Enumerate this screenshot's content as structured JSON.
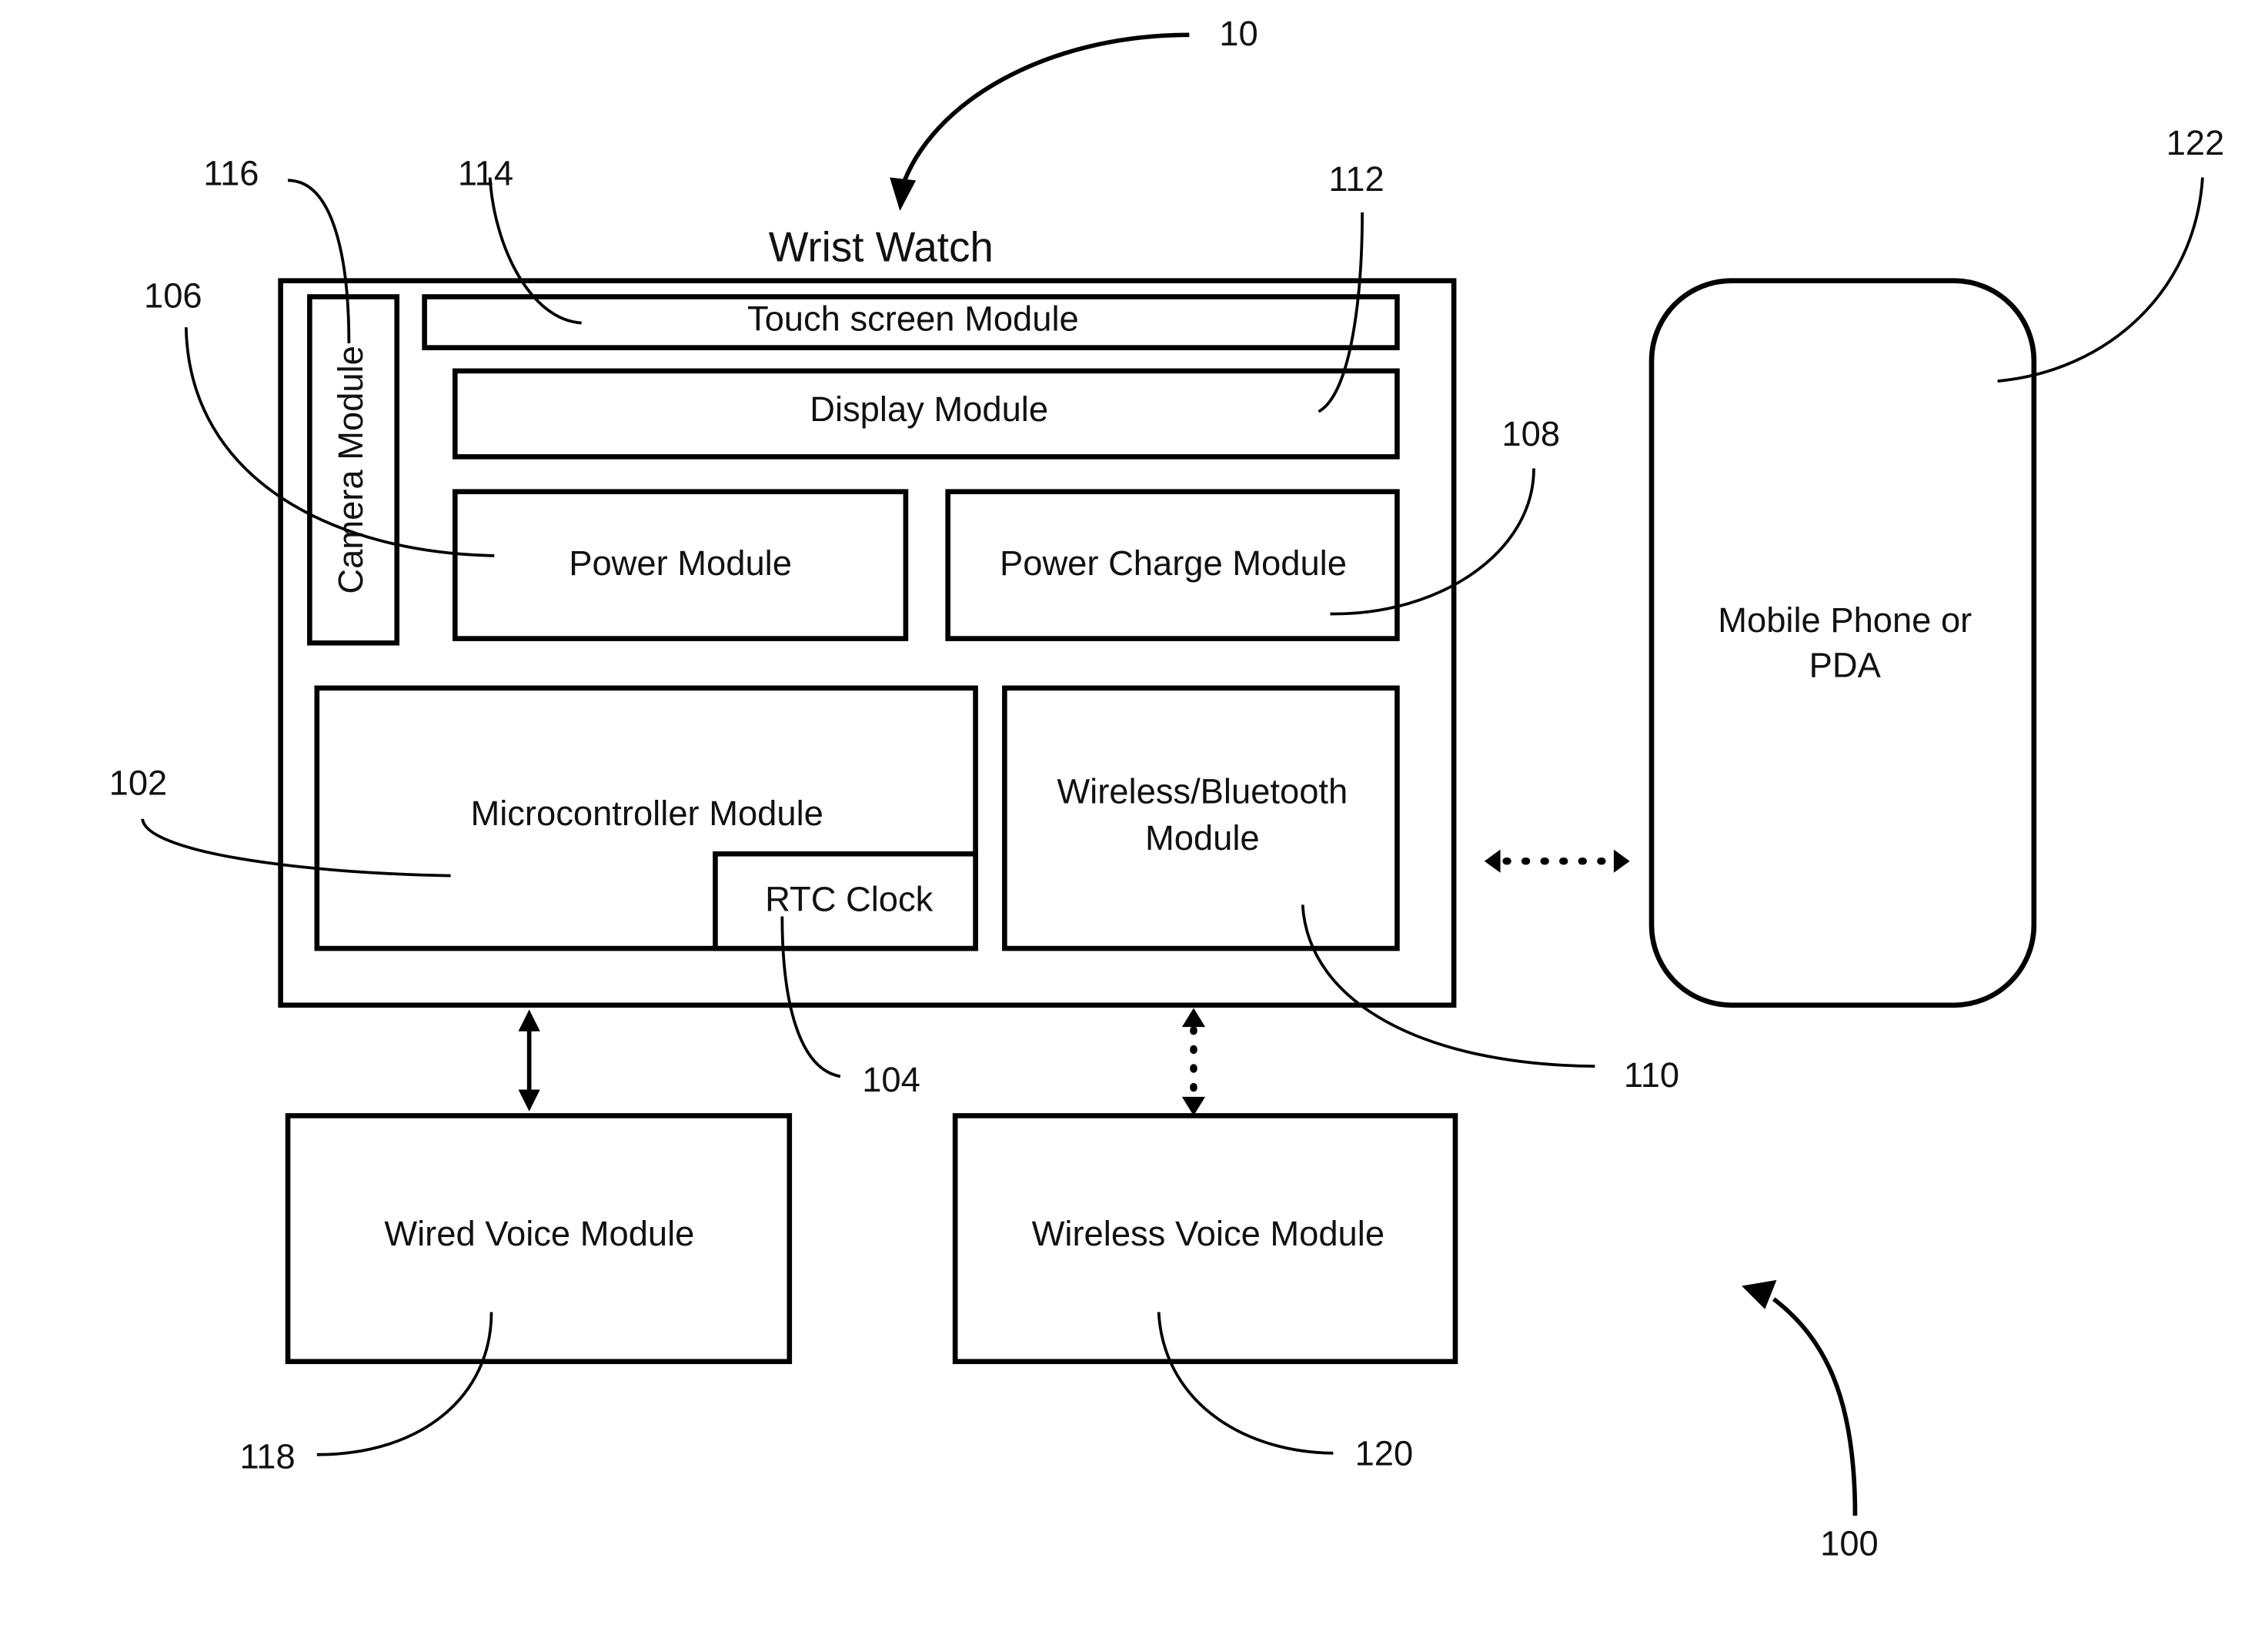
{
  "figure": {
    "title": "Wrist Watch",
    "figure_ref": "10",
    "system_ref": "100"
  },
  "modules": {
    "touch_screen": {
      "label": "Touch screen Module",
      "ref": "114"
    },
    "display": {
      "label": "Display Module",
      "ref": "112"
    },
    "camera": {
      "label": "Camera Module",
      "ref": "116"
    },
    "power": {
      "label": "Power Module",
      "ref": "106"
    },
    "power_charge": {
      "label": "Power Charge Module",
      "ref": "108"
    },
    "microcontroller": {
      "label": "Microcontroller Module",
      "ref": "102"
    },
    "rtc_clock": {
      "label": "RTC Clock",
      "ref": "104"
    },
    "wireless_bluetooth": {
      "label_line1": "Wireless/Bluetooth",
      "label_line2": "Module",
      "ref": "110"
    },
    "wired_voice": {
      "label": "Wired Voice Module",
      "ref": "118"
    },
    "wireless_voice": {
      "label": "Wireless Voice Module",
      "ref": "120"
    },
    "mobile_phone": {
      "label_line1": "Mobile Phone or",
      "label_line2": "PDA",
      "ref": "122"
    }
  },
  "connections": [
    {
      "from": "Wrist Watch",
      "to": "Wired Voice Module",
      "style": "solid",
      "direction": "bidirectional"
    },
    {
      "from": "Wrist Watch",
      "to": "Wireless Voice Module",
      "style": "dotted",
      "direction": "bidirectional"
    },
    {
      "from": "Wrist Watch",
      "to": "Mobile Phone or PDA",
      "style": "dotted",
      "direction": "bidirectional"
    }
  ]
}
